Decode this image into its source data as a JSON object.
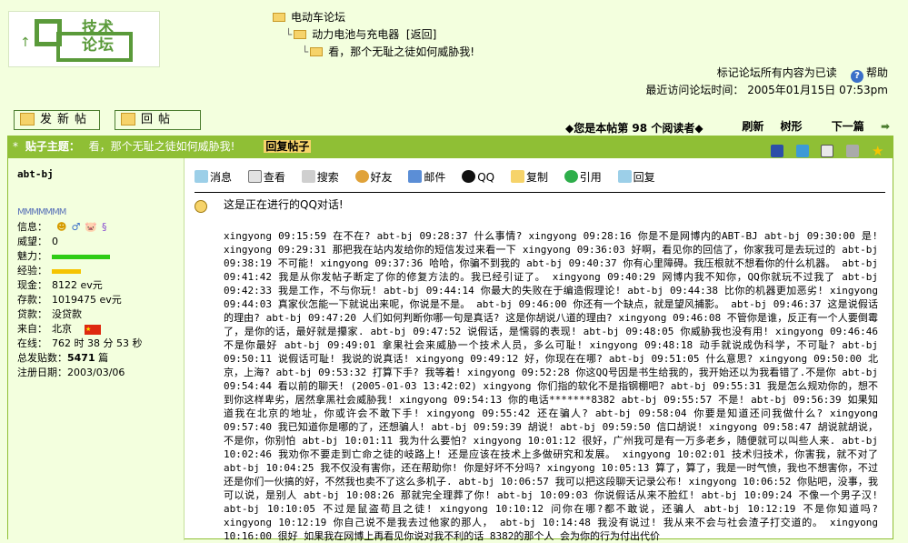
{
  "breadcrumb": {
    "forum": "电动车论坛",
    "subforum": "动力电池与充电器",
    "back": "[返回]",
    "thread": "看，那个无耻之徒如何威胁我!"
  },
  "logo_text_1": "技术",
  "logo_text_2": "论坛",
  "header": {
    "mark_read": "标记论坛所有内容为已读",
    "help": "帮助",
    "last_visit": "最近访问论坛时间： 2005年01月15日 07:53pm"
  },
  "buttons": {
    "new_post": "发新帖",
    "reply": "回帖"
  },
  "readers": {
    "prefix": "◆您是本帖第",
    "count": "98",
    "suffix": "个阅读者◆"
  },
  "nav": {
    "refresh": "刷新",
    "tree": "树形",
    "next": "下一篇"
  },
  "subject": {
    "label": "贴子主题：",
    "topic": "看，那个无耻之徒如何威胁我!",
    "reply_link": "回复帖子"
  },
  "user": {
    "name": "abt-bj",
    "badges": "MMMMMMM",
    "info_label": "信息：",
    "prestige_label": "威望：",
    "prestige": "0",
    "charm_label": "魅力：",
    "exp_label": "经验：",
    "cash_label": "现金：",
    "cash": "8122 ev元",
    "deposit_label": "存款：",
    "deposit": "1019475 ev元",
    "loan_label": "贷款：",
    "loan": "没贷款",
    "from_label": "来自：",
    "from": "北京",
    "online_label": "在线：",
    "online": "762 时 38 分 53 秒",
    "posts_label": "总发贴数：",
    "posts": "5471",
    "posts_unit": "篇",
    "regdate_label": "注册日期：",
    "regdate": "2003/03/06"
  },
  "actions": [
    "消息",
    "查看",
    "搜索",
    "好友",
    "邮件",
    "QQ",
    "复制",
    "引用",
    "回复"
  ],
  "post": {
    "lead": "这是正在进行的QQ对话!",
    "text": "xingyong 09:15:59 在不在?  abt-bj 09:28:37 什么事情?  xingyong 09:28:16 你是不是网博内的ABT-BJ  abt-bj 09:30:00 是!  xingyong 09:29:31 那把我在站内发给你的短信发过来看一下  xingyong 09:36:03 好啊，看见你的回信了，你家我可是去玩过的  abt-bj 09:38:19 不可能!  xingyong 09:37:36 哈哈，你骗不到我的  abt-bj 09:40:37 你有心里障碍。我压根就不想看你的什么机器。  abt-bj 09:41:42 我是从你发帖子断定了你的修复方法的。我已经引证了。  xingyong 09:40:29 网博内我不知你，QQ你就玩不过我了  abt-bj 09:42:33 我是工作，不与你玩!  abt-bj 09:44:14 你最大的失败在于编造假理论!  abt-bj 09:44:38 比你的机器更加恶劣!  xingyong 09:44:03 真家伙怎能一下就说出来呢，你说是不是。  abt-bj 09:46:00 你还有一个缺点，就是望风捕影。  abt-bj 09:46:37 这是说假话的理由?  abt-bj 09:47:20 人们如何判断你哪一句是真话? 这是你胡说八道的理由?  xingyong 09:46:08 不管你是谁，反正有一个人要倒霉了，是你的话，最好就是攥家.  abt-bj 09:47:52 说假话，是懦弱的表现!  abt-bj 09:48:05 你威胁我也没有用!  xingyong 09:46:46 不是你最好  abt-bj 09:49:01 拿果社会来威胁一个技术人员，多么可耻!  xingyong 09:48:18 动手就说成伪科学，不可耻?  abt-bj 09:50:11 说假话可耻! 我说的说真话!  xingyong 09:49:12 好，你现在在哪?  abt-bj 09:51:05 什么意思?  xingyong 09:50:00 北京，上海?  abt-bj 09:53:32 打算下手? 我等着!  xingyong 09:52:28 你这QQ号因是书生给我的，我开始还以为我看错了.不是你  abt-bj 09:54:44 看以前的聊天! (2005-01-03 13:42:02)  xingyong 你们指的软化不是指钢棚吧?  abt-bj 09:55:31 我是怎么规劝你的，想不到你这样卑劣，居然拿黑社会威胁我!  xingyong 09:54:13 你的电话*******8382  abt-bj 09:55:57 不是!  abt-bj 09:56:39 如果知道我在北京的地址，你或许会不敢下手!  xingyong 09:55:42 还在骗人?  abt-bj 09:58:04 你要是知道还问我做什么?  xingyong 09:57:40 我已知道你是哪的了，还想骗人!  abt-bj 09:59:39 胡说!  abt-bj 09:59:50 信口胡说!  xingyong 09:58:47 胡说就胡说，不是你，你别怕  abt-bj 10:01:11 我为什么要怕?  xingyong 10:01:12 很好，广州我可是有一万多老乡，随便就可以叫些人来.  abt-bj 10:02:46 我劝你不要走到亡命之徒的岐路上!  还是应该在技术上多做研究和发展。  xingyong 10:02:01 技术归技术，你害我，就不对了  abt-bj 10:04:25 我不仅没有害你，还在帮助你!  你是好坏不分吗?  xingyong 10:05:13 算了，算了，我是一时气愤，我也不想害你，不过还是你们一伙搞的好，不然我也卖不了这么多机子.  abt-bj 10:06:57 我可以把这段聊天记录公布!  xingyong 10:06:52 你贴吧，没事，我可以说，是别人  abt-bj 10:08:26 那就完全理葬了你!  abt-bj 10:09:03 你说假话从来不脸红!  abt-bj 10:09:24 不像一个男子汉!  abt-bj 10:10:05 不过是鼠盗苟且之徒!  xingyong 10:10:12 问你在哪?都不敢说，还骗人  abt-bj 10:12:19 不是你知道吗?  xingyong 10:12:19 你自己说不是我去过他家的那人，  abt-bj 10:14:48 我没有说过!  我从来不会与社会渣子打交道的。  xingyong 10:16:00 很好 如果我在网博上再看见你说对我不利的话 8382的那个人 会为你的行为付出代价"
  },
  "colors": {
    "page_bg": "#f3ffde",
    "accent_green": "#8fbf35",
    "border_green": "#4b7d2f"
  }
}
